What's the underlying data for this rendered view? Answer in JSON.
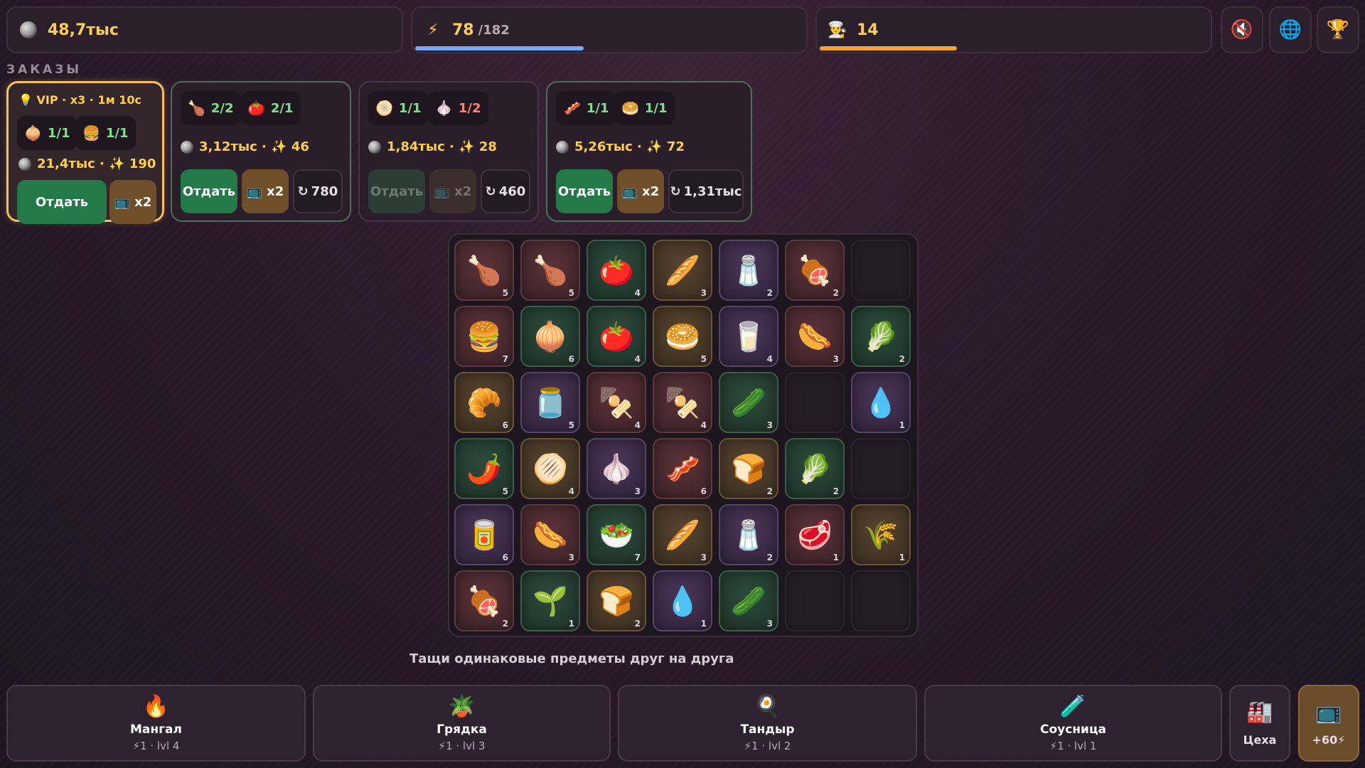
{
  "top": {
    "coins": {
      "icon": "coin-icon",
      "value": "48,7тыс"
    },
    "energy": {
      "icon": "lightning-icon",
      "value": "78",
      "max": "/182",
      "fill": 0.43,
      "bar_color": "#7aa8f2"
    },
    "level": {
      "icon": "chef-icon",
      "value": "14",
      "fill": 0.35,
      "bar_color": "#f5a623"
    },
    "buttons": {
      "sound": "speaker-muted-icon",
      "language": "globe-icon",
      "trophy": "trophy-icon"
    }
  },
  "orders": {
    "title": "ЗАКАЗЫ",
    "vip": {
      "label": "VIP · x3 · 1м 10с",
      "items": [
        {
          "emoji": "🧅",
          "count": "1/1",
          "status": "ok"
        },
        {
          "emoji": "🍔",
          "count": "1/1",
          "status": "ok"
        }
      ],
      "reward": "21,4тыс · ✨ 190",
      "give_label": "Отдать",
      "tv_label": "x2"
    },
    "list": [
      {
        "items": [
          {
            "emoji": "🍗",
            "count": "2/2",
            "status": "ok"
          },
          {
            "emoji": "🍅",
            "count": "2/1",
            "status": "ok"
          }
        ],
        "reward": "3,12тыс · ✨ 46",
        "give_label": "Отдать",
        "tv_label": "x2",
        "refresh_label": "780",
        "enabled": true
      },
      {
        "items": [
          {
            "emoji": "🫓",
            "count": "1/1",
            "status": "ok"
          },
          {
            "emoji": "🧄",
            "count": "1/2",
            "status": "bad"
          }
        ],
        "reward": "1,84тыс · ✨ 28",
        "give_label": "Отдать",
        "tv_label": "x2",
        "refresh_label": "460",
        "enabled": false
      },
      {
        "items": [
          {
            "emoji": "🥓",
            "count": "1/1",
            "status": "ok"
          },
          {
            "emoji": "🥯",
            "count": "1/1",
            "status": "ok"
          }
        ],
        "reward": "5,26тыс · ✨ 72",
        "give_label": "Отдать",
        "tv_label": "x2",
        "refresh_label": "1,31тыс",
        "enabled": true
      }
    ]
  },
  "board": {
    "rows": [
      [
        {
          "e": "🍗",
          "l": "5",
          "c": "red"
        },
        {
          "e": "🍗",
          "l": "5",
          "c": "red"
        },
        {
          "e": "🍅",
          "l": "4",
          "c": "green"
        },
        {
          "e": "🥖",
          "l": "3",
          "c": "gold"
        },
        {
          "e": "🧂",
          "l": "2",
          "c": "purple"
        },
        {
          "e": "🍖",
          "l": "2",
          "c": "red"
        },
        {
          "e": "",
          "l": "",
          "c": "empty"
        }
      ],
      [
        {
          "e": "🍔",
          "l": "7",
          "c": "red"
        },
        {
          "e": "🧅",
          "l": "6",
          "c": "green"
        },
        {
          "e": "🍅",
          "l": "4",
          "c": "green"
        },
        {
          "e": "🥯",
          "l": "5",
          "c": "gold"
        },
        {
          "e": "🥛",
          "l": "4",
          "c": "purple"
        },
        {
          "e": "🌭",
          "l": "3",
          "c": "red"
        },
        {
          "e": "🥬",
          "l": "2",
          "c": "green"
        }
      ],
      [
        {
          "e": "🥐",
          "l": "6",
          "c": "gold"
        },
        {
          "e": "🫙",
          "l": "5",
          "c": "purple"
        },
        {
          "e": "🍢",
          "l": "4",
          "c": "red"
        },
        {
          "e": "🍢",
          "l": "4",
          "c": "red"
        },
        {
          "e": "🥒",
          "l": "3",
          "c": "green"
        },
        {
          "e": "",
          "l": "",
          "c": "empty"
        },
        {
          "e": "💧",
          "l": "1",
          "c": "purple"
        }
      ],
      [
        {
          "e": "🌶️",
          "l": "5",
          "c": "green"
        },
        {
          "e": "🫓",
          "l": "4",
          "c": "gold"
        },
        {
          "e": "🧄",
          "l": "3",
          "c": "purple"
        },
        {
          "e": "🥓",
          "l": "6",
          "c": "red"
        },
        {
          "e": "🍞",
          "l": "2",
          "c": "gold"
        },
        {
          "e": "🥬",
          "l": "2",
          "c": "green"
        },
        {
          "e": "",
          "l": "",
          "c": "empty"
        }
      ],
      [
        {
          "e": "🥫",
          "l": "6",
          "c": "purple"
        },
        {
          "e": "🌭",
          "l": "3",
          "c": "red"
        },
        {
          "e": "🥗",
          "l": "7",
          "c": "green"
        },
        {
          "e": "🥖",
          "l": "3",
          "c": "gold"
        },
        {
          "e": "🧂",
          "l": "2",
          "c": "purple"
        },
        {
          "e": "🥩",
          "l": "1",
          "c": "red"
        },
        {
          "e": "🌾",
          "l": "1",
          "c": "gold"
        }
      ],
      [
        {
          "e": "🍖",
          "l": "2",
          "c": "red"
        },
        {
          "e": "🌱",
          "l": "1",
          "c": "green"
        },
        {
          "e": "🍞",
          "l": "2",
          "c": "gold"
        },
        {
          "e": "💧",
          "l": "1",
          "c": "purple"
        },
        {
          "e": "🥒",
          "l": "3",
          "c": "green"
        },
        {
          "e": "",
          "l": "",
          "c": "empty"
        },
        {
          "e": "",
          "l": "",
          "c": "empty"
        }
      ]
    ]
  },
  "hint": "Тащи одинаковые предметы друг на друга",
  "stations": [
    {
      "icon": "fire-icon",
      "emoji": "🔥",
      "name": "Мангал",
      "sub": "⚡1 · lvl 4"
    },
    {
      "icon": "plant-pot-icon",
      "emoji": "🪴",
      "name": "Грядка",
      "sub": "⚡1 · lvl 3"
    },
    {
      "icon": "frying-pan-icon",
      "emoji": "🍳",
      "name": "Тандыр",
      "sub": "⚡1 · lvl 2"
    },
    {
      "icon": "test-tube-icon",
      "emoji": "🧪",
      "name": "Соусница",
      "sub": "⚡1 · lvl 1"
    }
  ],
  "workshops": {
    "icon": "factory-icon",
    "emoji": "🏭",
    "label": "Цеха"
  },
  "ad_bonus": {
    "icon": "tv-icon",
    "emoji": "📺",
    "label": "+60⚡"
  }
}
